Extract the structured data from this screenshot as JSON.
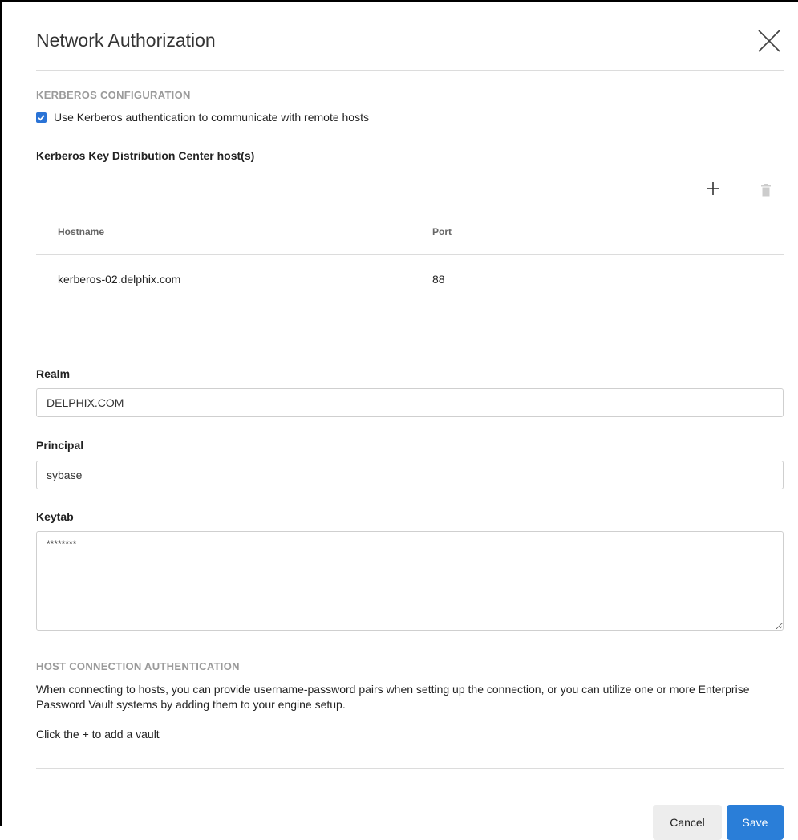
{
  "dialog": {
    "title": "Network Authorization"
  },
  "kerberos": {
    "section_heading": "KERBEROS CONFIGURATION",
    "use_kerberos_label": "Use Kerberos authentication to communicate with remote hosts",
    "use_kerberos_checked": true,
    "kdc_label": "Kerberos Key Distribution Center host(s)",
    "table": {
      "columns": [
        "Hostname",
        "Port"
      ],
      "rows": [
        {
          "hostname": "kerberos-02.delphix.com",
          "port": "88"
        }
      ]
    },
    "realm_label": "Realm",
    "realm_value": "DELPHIX.COM",
    "principal_label": "Principal",
    "principal_value": "sybase",
    "keytab_label": "Keytab",
    "keytab_value": "********"
  },
  "host_auth": {
    "section_heading": "HOST CONNECTION AUTHENTICATION",
    "description": "When connecting to hosts, you can provide username-password pairs when setting up the connection, or you can utilize one or more Enterprise Password Vault systems by adding them to your engine setup.",
    "hint": "Click the + to add a vault"
  },
  "footer": {
    "cancel_label": "Cancel",
    "save_label": "Save"
  },
  "colors": {
    "accent": "#2a7ed8",
    "section_heading": "#9a9a9a",
    "divider": "#dcdcdc"
  }
}
